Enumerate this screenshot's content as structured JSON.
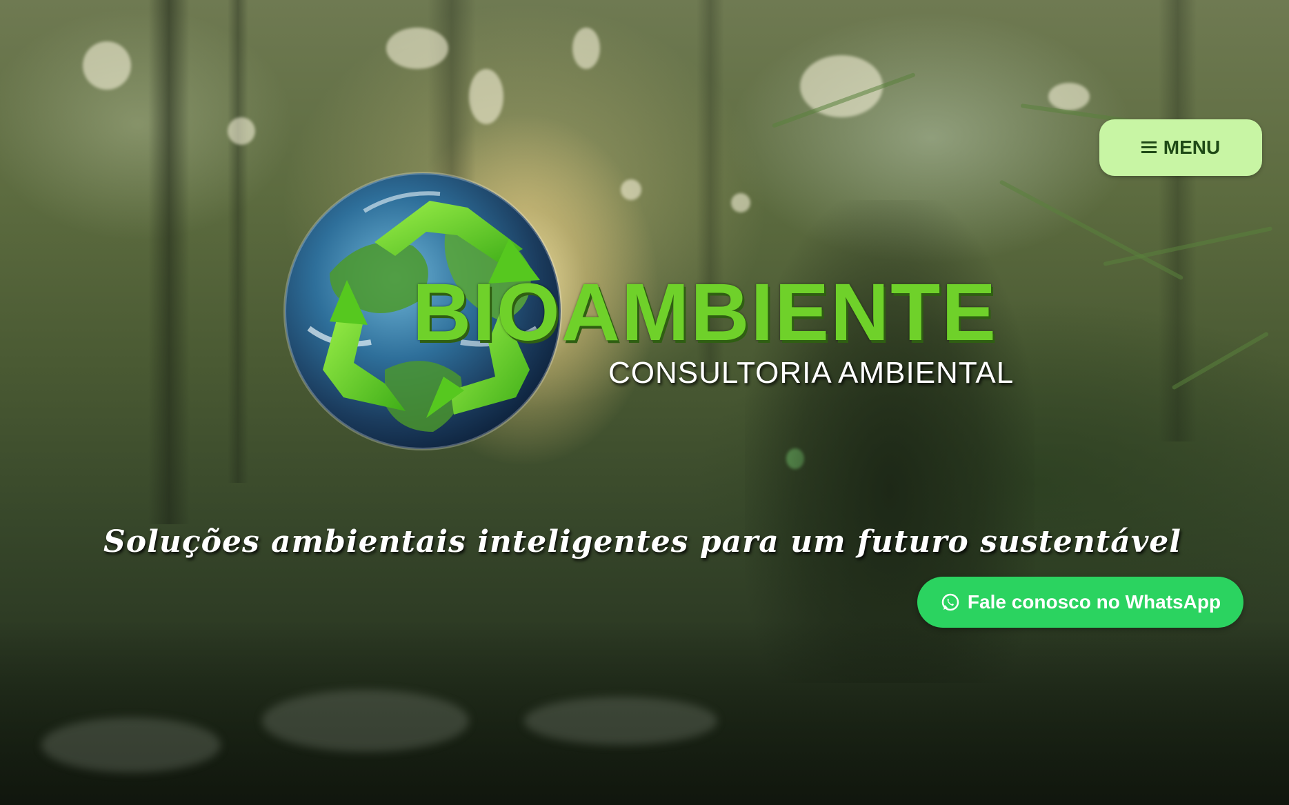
{
  "header": {
    "menu_label": "MENU",
    "menu_icon": "hamburger-icon"
  },
  "logo": {
    "name": "BIOAMBIENTE",
    "subtitle": "CONSULTORIA AMBIENTAL",
    "icon": "recycle-globe-icon"
  },
  "hero": {
    "tagline": "Soluções ambientais inteligentes para um futuro sustentável",
    "background": "forest-photo"
  },
  "cta": {
    "whatsapp_label": "Fale conosco no WhatsApp",
    "whatsapp_icon": "whatsapp-icon"
  },
  "colors": {
    "brand_green": "#6fd12a",
    "menu_bg": "#c8f5a4",
    "menu_text": "#1f4a16",
    "whatsapp_green": "#2bd360"
  }
}
